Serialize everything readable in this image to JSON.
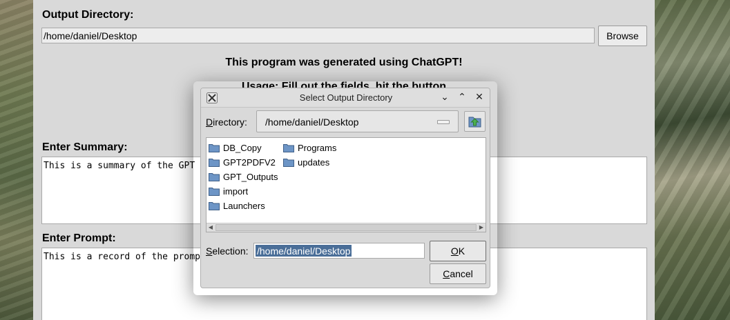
{
  "main_window": {
    "output_dir_label": "Output Directory:",
    "output_dir_value": "/home/daniel/Desktop",
    "browse_label": "Browse",
    "info_line1": "This program was generated using ChatGPT!",
    "info_line2": "Usage: Fill out the fields, hit the button",
    "summary_label": "Enter Summary:",
    "summary_text": "This is a summary of the GPT",
    "prompt_label": "Enter Prompt:",
    "prompt_text": "This is a record of the promp"
  },
  "dialog": {
    "title": "Select Output Directory",
    "directory_label": "Directory:",
    "directory_value": "/home/daniel/Desktop",
    "folders_col1": [
      "DB_Copy",
      "GPT2PDFV2",
      "GPT_Outputs",
      "import",
      "Launchers"
    ],
    "folders_col2": [
      "Programs",
      "updates"
    ],
    "selection_label": "Selection:",
    "selection_value": "/home/daniel/Desktop",
    "ok_label": "OK",
    "cancel_label": "Cancel"
  },
  "colors": {
    "window_bg": "#d9d9d9",
    "selection_highlight": "#4a6e98",
    "folder_icon": "#6d95c6"
  }
}
